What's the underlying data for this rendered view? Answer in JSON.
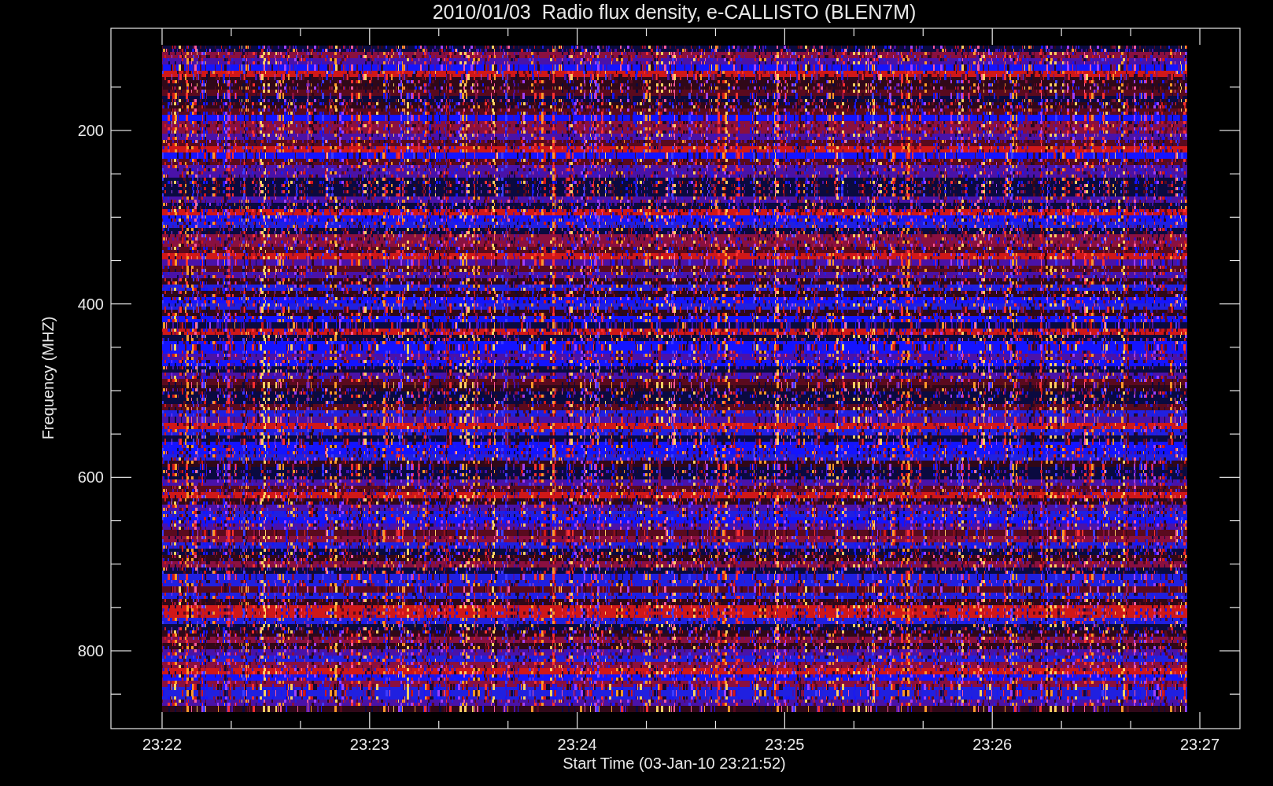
{
  "title": "2010/01/03  Radio flux density, e-CALLISTO (BLEN7M)",
  "y_axis": {
    "label": "Frequency (MHZ)",
    "ticks": [
      "200",
      "400",
      "600",
      "800"
    ]
  },
  "x_axis": {
    "label": "Start Time (03-Jan-10 23:21:52)",
    "ticks": [
      "23:22",
      "23:23",
      "23:24",
      "23:25",
      "23:26",
      "23:27"
    ]
  }
}
